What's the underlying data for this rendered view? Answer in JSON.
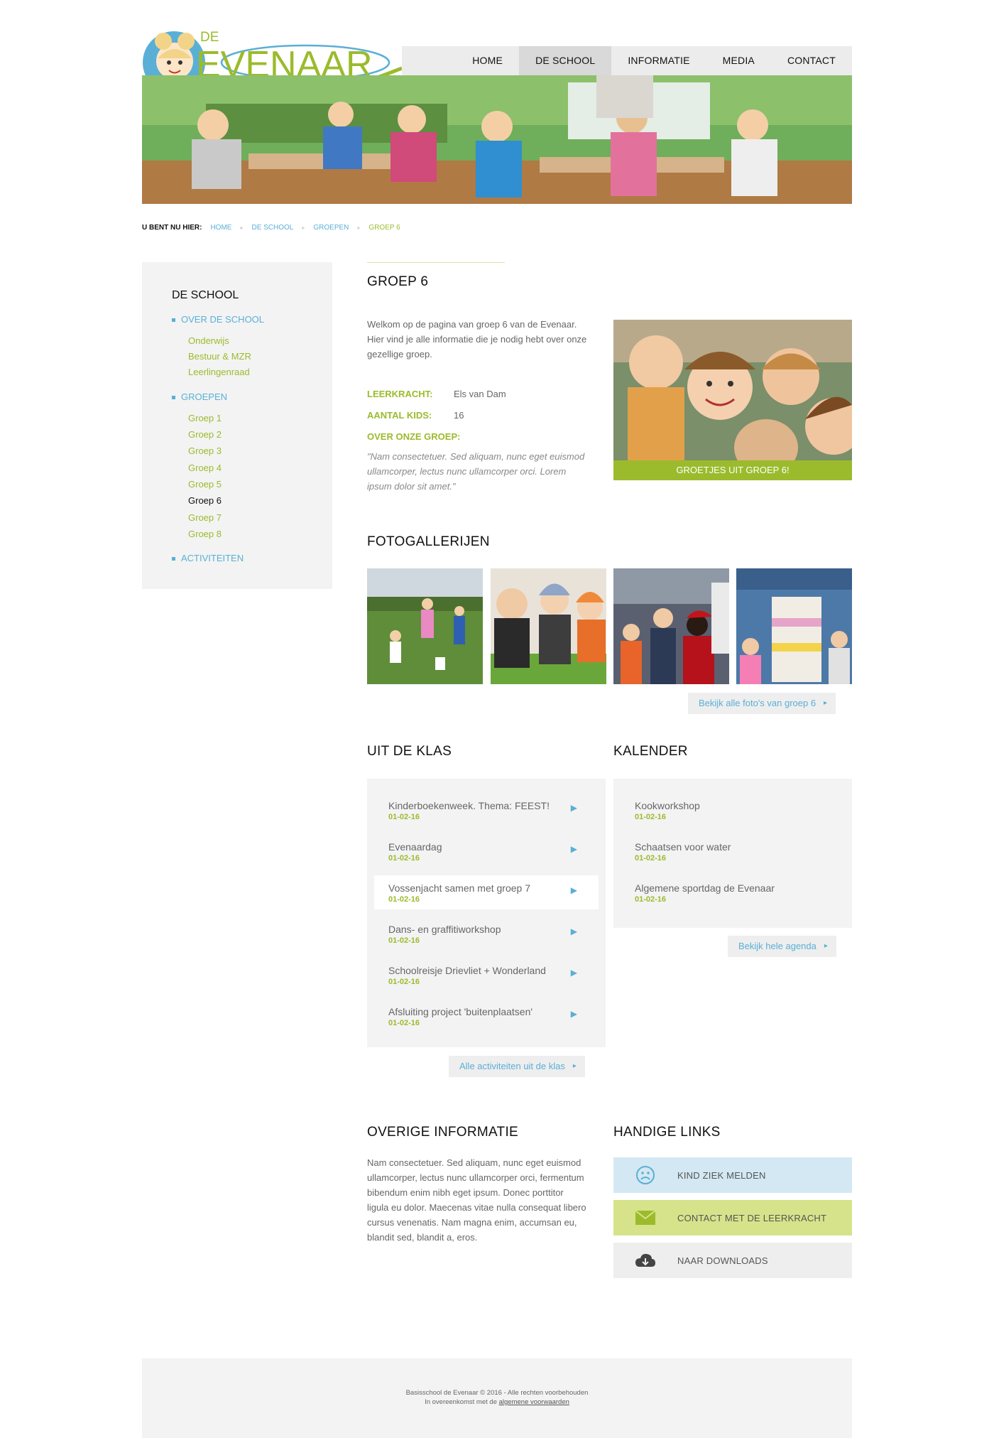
{
  "logo": {
    "small": "DE",
    "big": "EVENAAR"
  },
  "nav": {
    "items": [
      "HOME",
      "DE SCHOOL",
      "INFORMATIE",
      "MEDIA",
      "CONTACT"
    ],
    "active": "DE SCHOOL"
  },
  "breadcrumb": {
    "label": "U BENT NU HIER:",
    "items": [
      "HOME",
      "DE SCHOOL",
      "GROEPEN",
      "GROEP 6"
    ]
  },
  "sidebar": {
    "title": "DE SCHOOL",
    "sections": [
      {
        "label": "OVER DE SCHOOL",
        "links": [
          "Onderwijs",
          "Bestuur & MZR",
          "Leerlingenraad"
        ]
      },
      {
        "label": "GROEPEN",
        "links": [
          "Groep 1",
          "Groep 2",
          "Groep 3",
          "Groep 4",
          "Groep 5",
          "Groep 6",
          "Groep 7",
          "Groep 8"
        ],
        "current": "Groep 6"
      },
      {
        "label": "ACTIVITEITEN",
        "links": []
      }
    ]
  },
  "main": {
    "title": "GROEP 6",
    "intro": "Welkom op de pagina van groep 6 van de Evenaar. Hier vind je alle informatie die je nodig hebt over onze gezellige groep.",
    "teacher_label": "LEERKRACHT:",
    "teacher": "Els van Dam",
    "kids_label": "AANTAL KIDS:",
    "kids": "16",
    "about_label": "OVER ONZE GROEP:",
    "quote": "\"Nam consectetuer. Sed aliquam, nunc eget euismod ullamcorper, lectus nunc ullamcorper orci. Lorem ipsum dolor sit amet.\"",
    "photo_caption": "GROETJES UIT GROEP 6!"
  },
  "gallery": {
    "title": "FOTOGALLERIJEN",
    "more": "Bekijk alle foto's van groep 6"
  },
  "class_news": {
    "title": "UIT DE KLAS",
    "items": [
      {
        "title": "Kinderboekenweek. Thema: FEEST!",
        "date": "01-02-16"
      },
      {
        "title": "Evenaardag",
        "date": "01-02-16"
      },
      {
        "title": "Vossenjacht samen met groep 7",
        "date": "01-02-16"
      },
      {
        "title": "Dans- en graffitiworkshop",
        "date": "01-02-16"
      },
      {
        "title": "Schoolreisje Drievliet + Wonderland",
        "date": "01-02-16"
      },
      {
        "title": "Afsluiting project 'buitenplaatsen'",
        "date": "01-02-16"
      }
    ],
    "more": "Alle activiteiten uit de klas"
  },
  "calendar": {
    "title": "KALENDER",
    "items": [
      {
        "title": "Kookworkshop",
        "date": "01-02-16"
      },
      {
        "title": "Schaatsen voor water",
        "date": "01-02-16"
      },
      {
        "title": "Algemene sportdag de Evenaar",
        "date": "01-02-16"
      }
    ],
    "more": "Bekijk hele agenda"
  },
  "other_info": {
    "title": "OVERIGE INFORMATIE",
    "text": "Nam consectetuer. Sed aliquam, nunc eget euismod ullamcorper, lectus nunc ullamcorper orci, fermentum bibendum enim nibh eget ipsum. Donec porttitor ligula eu dolor. Maecenas vitae nulla consequat libero cursus venenatis. Nam magna enim, accumsan eu, blandit sed, blandit a, eros."
  },
  "handy_links": {
    "title": "HANDIGE LINKS",
    "items": [
      {
        "label": "KIND ZIEK MELDEN",
        "icon": "sad-face-icon",
        "bg": "#d3e8f2"
      },
      {
        "label": "CONTACT MET DE LEERKRACHT",
        "icon": "envelope-icon",
        "bg": "#d6e38a"
      },
      {
        "label": "NAAR DOWNLOADS",
        "icon": "cloud-download-icon",
        "bg": "#eeeeee"
      }
    ]
  },
  "footer": {
    "line1": "Basisschool de Evenaar © 2016 - Alle rechten voorbehouden",
    "line2_pre": "In overeenkomst met de",
    "line2_link": "algemene voorwaarden"
  },
  "colors": {
    "green": "#9bbb2c",
    "blue": "#5aafd6",
    "grey": "#f3f3f3"
  }
}
